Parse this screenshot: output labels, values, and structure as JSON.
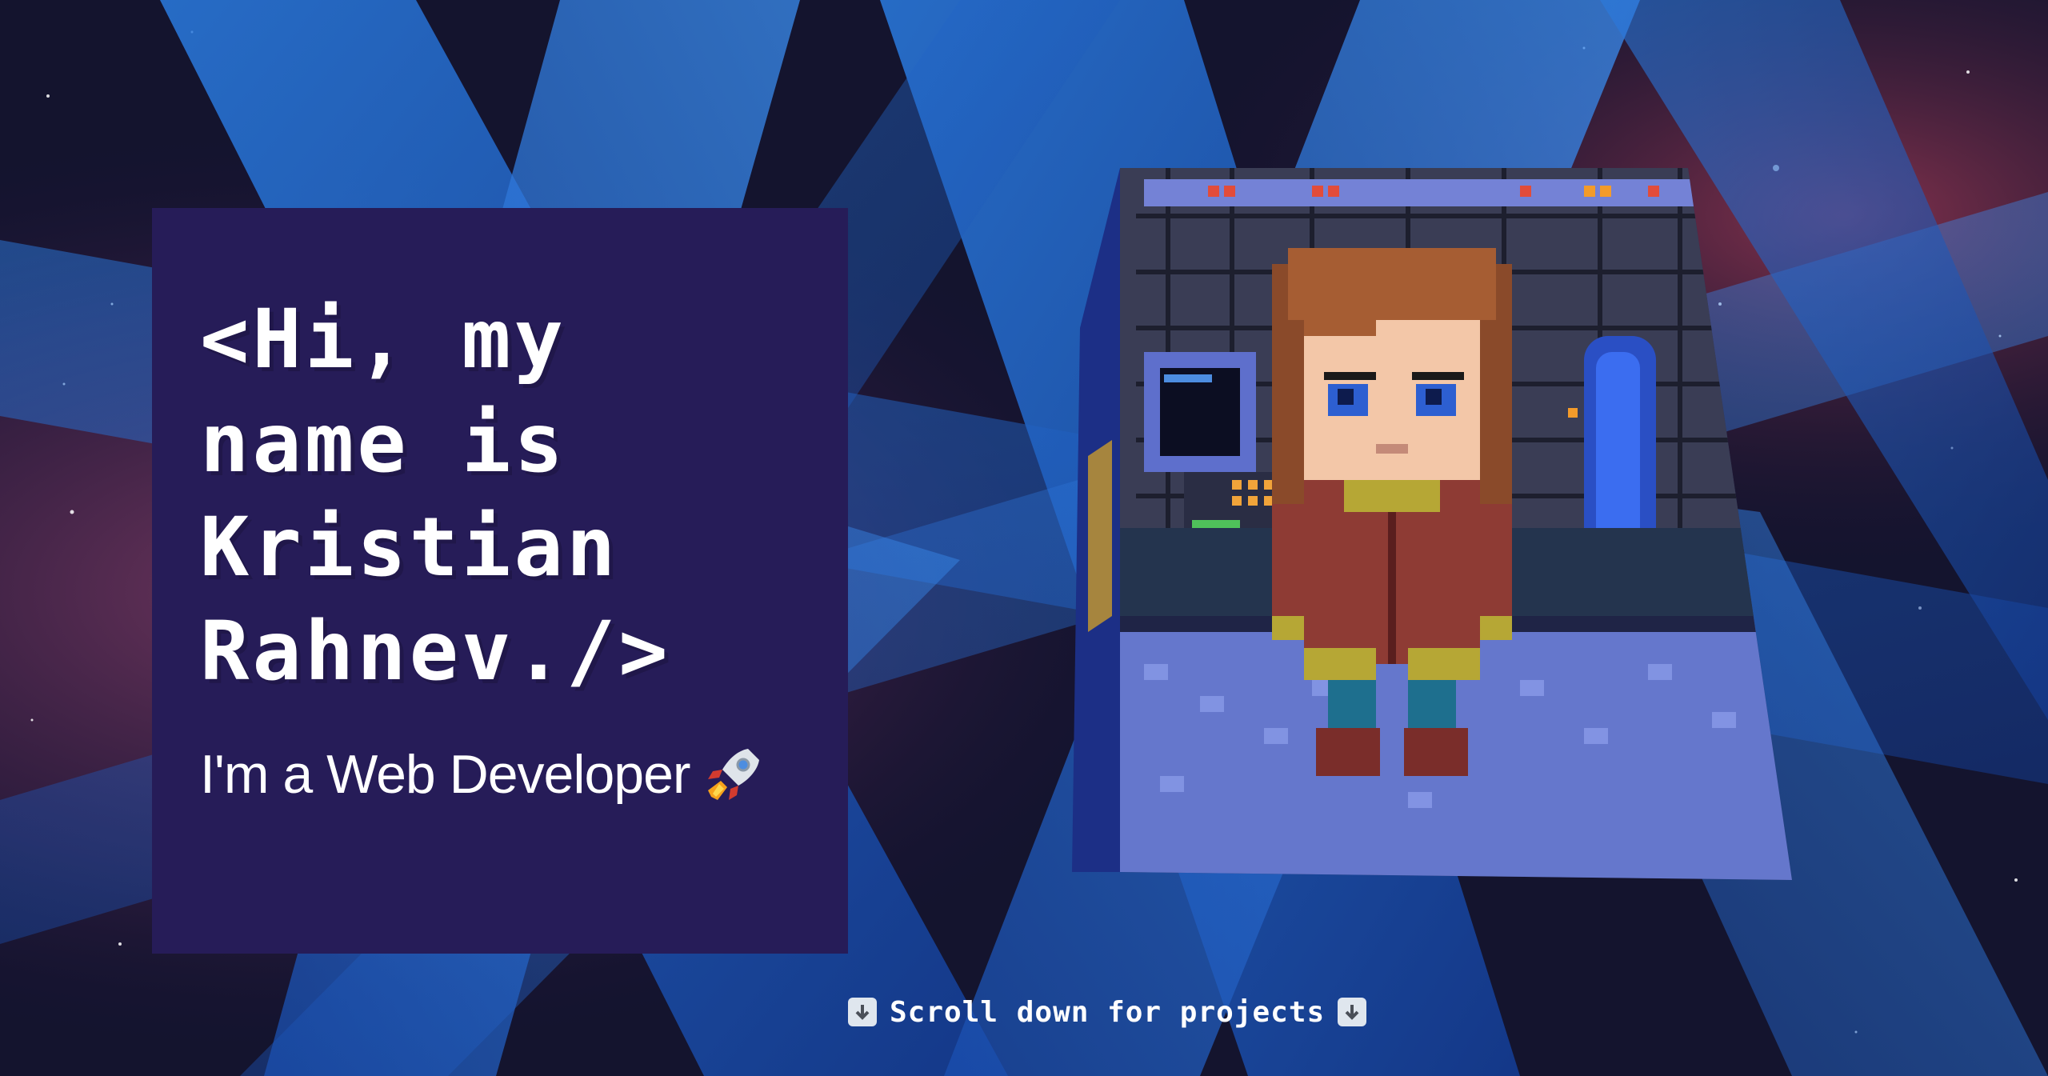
{
  "intro": {
    "heading": "<Hi, my\nname is\nKristian\nRahnev./>",
    "subtitle": "I'm a Web Developer",
    "subtitle_icon": "rocket-icon"
  },
  "avatar": {
    "description_icon": "pixel-art-avatar-icon"
  },
  "scroll_hint": {
    "label": "Scroll down for projects",
    "icon": "arrow-down-icon"
  },
  "colors": {
    "card_background": "#261c58",
    "text": "#ffffff",
    "space_background": "#0d1030",
    "ribbon_blue": "#1f63c6"
  }
}
